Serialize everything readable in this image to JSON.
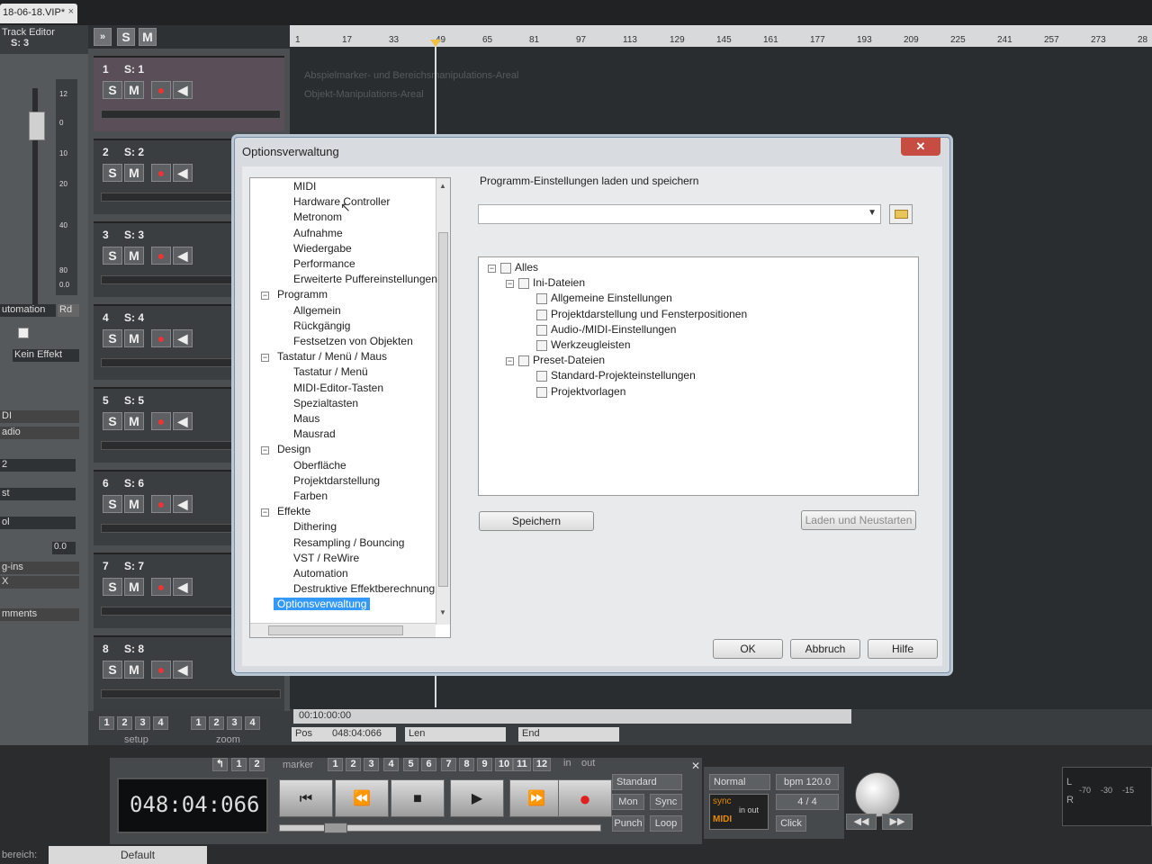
{
  "file_tab": {
    "title": "18-06-18.VIP*",
    "close": "×"
  },
  "inspector": {
    "title": "Track Editor",
    "track_id": "S: 3",
    "scale": [
      "12",
      "0",
      "10",
      "20",
      "40",
      "80",
      "0.0"
    ],
    "automation_label": "utomation",
    "automation_mode": "Rd",
    "effect": "Kein Effekt",
    "value": "0.0",
    "labels": [
      "DI",
      "adio",
      "2",
      "st",
      "ol",
      "g-ins",
      "X",
      "mments"
    ]
  },
  "tracklist": {
    "s_label": "S",
    "m_label": "M",
    "tracks": [
      {
        "num": "1",
        "name": "S: 1"
      },
      {
        "num": "2",
        "name": "S: 2"
      },
      {
        "num": "3",
        "name": "S: 3"
      },
      {
        "num": "4",
        "name": "S: 4"
      },
      {
        "num": "5",
        "name": "S: 5"
      },
      {
        "num": "6",
        "name": "S: 6"
      },
      {
        "num": "7",
        "name": "S: 7"
      },
      {
        "num": "8",
        "name": "S: 8"
      }
    ],
    "setup_label": "setup",
    "zoom_label": "zoom",
    "nums": [
      "1",
      "2",
      "3",
      "4"
    ]
  },
  "ruler": {
    "ticks": [
      "1",
      "17",
      "33",
      "49",
      "65",
      "81",
      "97",
      "113",
      "129",
      "145",
      "161",
      "177",
      "193",
      "209",
      "225",
      "241",
      "257",
      "273",
      "28"
    ]
  },
  "arrange": {
    "hint1": "Abspielmarker- und Bereichsmanipulations-Areal",
    "hint2": "Objekt-Manipulations-Areal",
    "time": "00:10:00:00",
    "pos_label": "Pos",
    "pos_value": "048:04:066",
    "len_label": "Len",
    "end_label": "End"
  },
  "dialog": {
    "title": "Optionsverwaltung",
    "close": "✕",
    "tree": [
      {
        "label": "MIDI",
        "level": 2
      },
      {
        "label": "Hardware Controller",
        "level": 2
      },
      {
        "label": "Metronom",
        "level": 2
      },
      {
        "label": "Aufnahme",
        "level": 2
      },
      {
        "label": "Wiedergabe",
        "level": 2
      },
      {
        "label": "Performance",
        "level": 2
      },
      {
        "label": "Erweiterte Puffereinstellungen",
        "level": 2
      },
      {
        "label": "Programm",
        "level": 1
      },
      {
        "label": "Allgemein",
        "level": 2
      },
      {
        "label": "Rückgängig",
        "level": 2
      },
      {
        "label": "Festsetzen von Objekten",
        "level": 2
      },
      {
        "label": "Tastatur / Menü / Maus",
        "level": 1
      },
      {
        "label": "Tastatur / Menü",
        "level": 2
      },
      {
        "label": "MIDI-Editor-Tasten",
        "level": 2
      },
      {
        "label": "Spezialtasten",
        "level": 2
      },
      {
        "label": "Maus",
        "level": 2
      },
      {
        "label": "Mausrad",
        "level": 2
      },
      {
        "label": "Design",
        "level": 1
      },
      {
        "label": "Oberfläche",
        "level": 2
      },
      {
        "label": "Projektdarstellung",
        "level": 2
      },
      {
        "label": "Farben",
        "level": 2
      },
      {
        "label": "Effekte",
        "level": 1
      },
      {
        "label": "Dithering",
        "level": 2
      },
      {
        "label": "Resampling / Bouncing",
        "level": 2
      },
      {
        "label": "VST / ReWire",
        "level": 2
      },
      {
        "label": "Automation",
        "level": 2
      },
      {
        "label": "Destruktive Effektberechnung",
        "level": 2
      },
      {
        "label": "Optionsverwaltung",
        "level": 1
      }
    ],
    "right_title": "Programm-Einstellungen laden und speichern",
    "combo_value": "",
    "checks": [
      {
        "label": "Alles",
        "level": 0
      },
      {
        "label": "Ini-Dateien",
        "level": 1
      },
      {
        "label": "Allgemeine Einstellungen",
        "level": 2
      },
      {
        "label": "Projektdarstellung und Fensterpositionen",
        "level": 2
      },
      {
        "label": "Audio-/MIDI-Einstellungen",
        "level": 2
      },
      {
        "label": "Werkzeugleisten",
        "level": 2
      },
      {
        "label": "Preset-Dateien",
        "level": 1
      },
      {
        "label": "Standard-Projekteinstellungen",
        "level": 2
      },
      {
        "label": "Projektvorlagen",
        "level": 2
      }
    ],
    "save": "Speichern",
    "load_restart": "Laden und Neustarten",
    "ok": "OK",
    "cancel": "Abbruch",
    "help": "Hilfe"
  },
  "transport": {
    "counter": "048:04:066",
    "marker_label": "marker",
    "marker_nums": [
      "1",
      "2",
      "3",
      "4",
      "5",
      "6",
      "7",
      "8",
      "9",
      "10",
      "11",
      "12"
    ],
    "in_label": "in",
    "out_label": "out",
    "loop_nums": [
      "1",
      "2"
    ],
    "mode": "Standard",
    "mon": "Mon",
    "sync": "Sync",
    "punch": "Punch",
    "loop": "Loop",
    "normal": "Normal",
    "bpm": "bpm 120.0",
    "meter": "4 / 4",
    "click": "Click",
    "sync_label": "sync",
    "midi_label": "MIDI",
    "in_out": "in out",
    "meter_scale": [
      "-70",
      "-30",
      "-15"
    ],
    "lr": [
      "L",
      "R"
    ],
    "bereich_label": "bereich:",
    "default": "Default"
  },
  "colors": {
    "accent": "#3399ff",
    "record": "#e02020",
    "bg": "#202224"
  }
}
